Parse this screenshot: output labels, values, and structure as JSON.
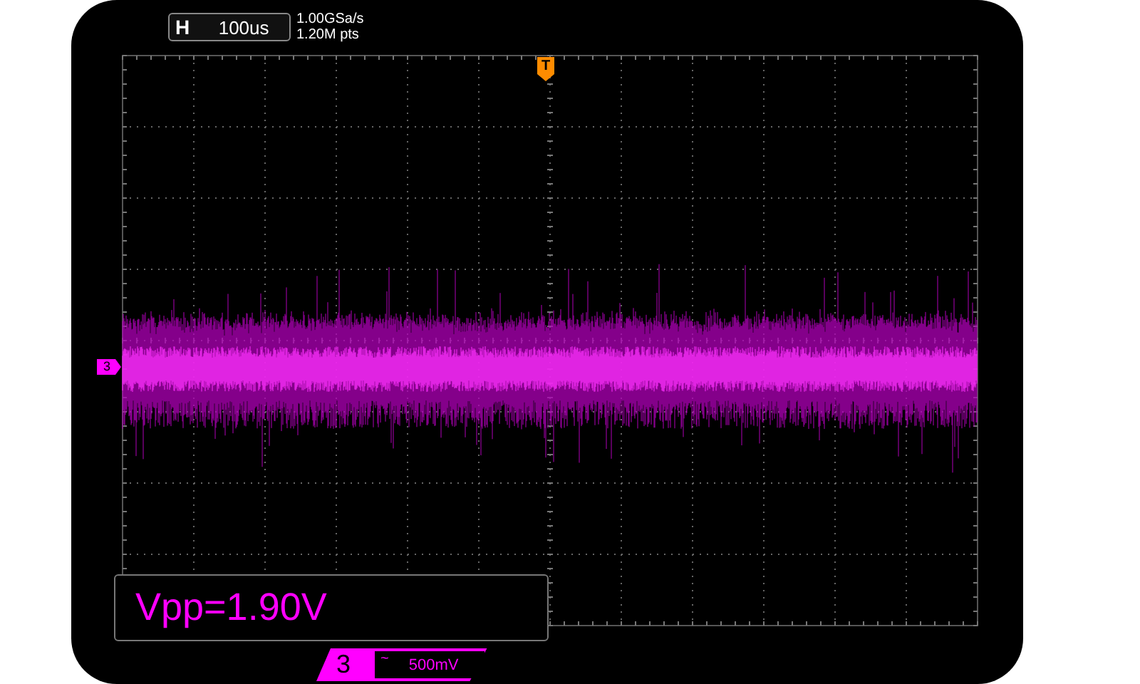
{
  "timebase": {
    "label": "H",
    "value": "100us"
  },
  "acquisition": {
    "sample_rate": "1.00GSa/s",
    "memory_depth": "1.20M pts"
  },
  "trigger_marker": {
    "label": "T"
  },
  "channel_marker": {
    "label": "3"
  },
  "measurement": {
    "text": "Vpp=1.90V"
  },
  "channel_badge": {
    "number": "3",
    "coupling": "~",
    "scale": "500mV"
  }
}
